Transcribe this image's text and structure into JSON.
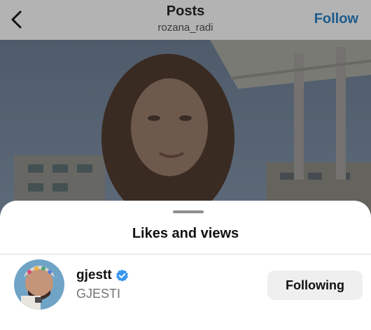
{
  "header": {
    "title": "Posts",
    "subtitle": "rozana_radi",
    "follow_label": "Follow",
    "back_icon": "chevron-left-icon"
  },
  "sheet": {
    "title": "Likes and views",
    "users": [
      {
        "username": "gjestt",
        "full_name": "GJESTI",
        "verified": true,
        "button_label": "Following"
      }
    ]
  },
  "colors": {
    "follow_link": "#1e5c8c",
    "verified_badge": "#3897f0",
    "secondary_text": "#737373",
    "button_bg": "#efefef"
  }
}
